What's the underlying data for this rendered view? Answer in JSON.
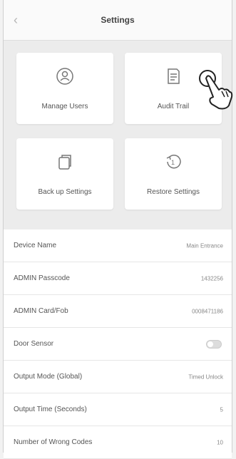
{
  "header": {
    "title": "Settings",
    "back_icon": "chevron-left-icon"
  },
  "tiles": [
    {
      "label": "Manage Users",
      "icon": "user-icon"
    },
    {
      "label": "Audit Trail",
      "icon": "document-icon"
    },
    {
      "label": "Back up Settings",
      "icon": "backup-icon"
    },
    {
      "label": "Restore Settings",
      "icon": "restore-icon"
    }
  ],
  "settings": [
    {
      "label": "Device Name",
      "value": "Main Entrance"
    },
    {
      "label": "ADMIN Passcode",
      "value": "1432256"
    },
    {
      "label": "ADMIN Card/Fob",
      "value": "0008471186"
    },
    {
      "label": "Door Sensor",
      "value": ""
    },
    {
      "label": "Output Mode (Global)",
      "value": "Timed Unlock"
    },
    {
      "label": "Output Time (Seconds)",
      "value": "5"
    },
    {
      "label": "Number of Wrong Codes",
      "value": "10"
    }
  ],
  "cursor": {
    "icon": "pointing-hand-icon"
  },
  "colors": {
    "background": "#ececec",
    "card": "#ffffff",
    "text": "#555555"
  }
}
